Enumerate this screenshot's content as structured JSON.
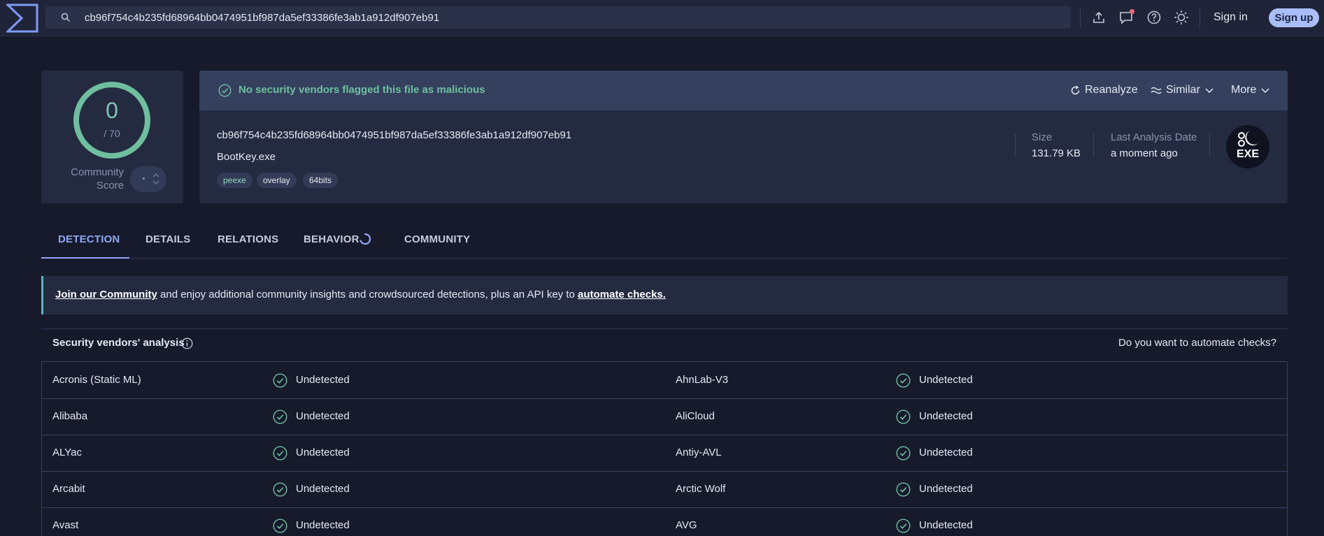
{
  "topbar": {
    "search_value": "cb96f754c4b235fd68964bb0474951bf987da5ef33386fe3ab1a912df907eb91",
    "sign_in": "Sign in",
    "sign_up": "Sign up",
    "icons": [
      "upload-icon",
      "chat-icon",
      "help-icon",
      "theme-icon"
    ]
  },
  "score": {
    "value": "0",
    "total": "/ 70",
    "community_label": "Community Score"
  },
  "banner": {
    "message": "No security vendors flagged this file as malicious",
    "reanalyze": "Reanalyze",
    "similar": "Similar",
    "more": "More"
  },
  "file": {
    "hash": "cb96f754c4b235fd68964bb0474951bf987da5ef33386fe3ab1a912df907eb91",
    "name": "BootKey.exe",
    "tags": [
      "peexe",
      "overlay",
      "64bits"
    ],
    "size_label": "Size",
    "size_value": "131.79 KB",
    "last_analysis_label": "Last Analysis Date",
    "last_analysis_value": "a moment ago",
    "type_icon_label": "EXE"
  },
  "tabs": [
    "DETECTION",
    "DETAILS",
    "RELATIONS",
    "BEHAVIOR",
    "COMMUNITY"
  ],
  "join": {
    "link1": "Join our Community",
    "middle": " and enjoy additional community insights and crowdsourced detections, plus an API key to ",
    "link2": "automate checks."
  },
  "vendors": {
    "title": "Security vendors' analysis",
    "automate_prompt": "Do you want to automate checks?",
    "rows": [
      {
        "left_name": "Acronis (Static ML)",
        "left_status": "Undetected",
        "right_name": "AhnLab-V3",
        "right_status": "Undetected"
      },
      {
        "left_name": "Alibaba",
        "left_status": "Undetected",
        "right_name": "AliCloud",
        "right_status": "Undetected"
      },
      {
        "left_name": "ALYac",
        "left_status": "Undetected",
        "right_name": "Antiy-AVL",
        "right_status": "Undetected"
      },
      {
        "left_name": "Arcabit",
        "left_status": "Undetected",
        "right_name": "Arctic Wolf",
        "right_status": "Undetected"
      },
      {
        "left_name": "Avast",
        "left_status": "Undetected",
        "right_name": "AVG",
        "right_status": "Undetected"
      }
    ]
  },
  "colors": {
    "background": "#161a2b",
    "panel": "#242a40",
    "accent": "#8fa8f5",
    "clean_green": "#6fbf9e",
    "signup_bg": "#a9bdf9"
  }
}
